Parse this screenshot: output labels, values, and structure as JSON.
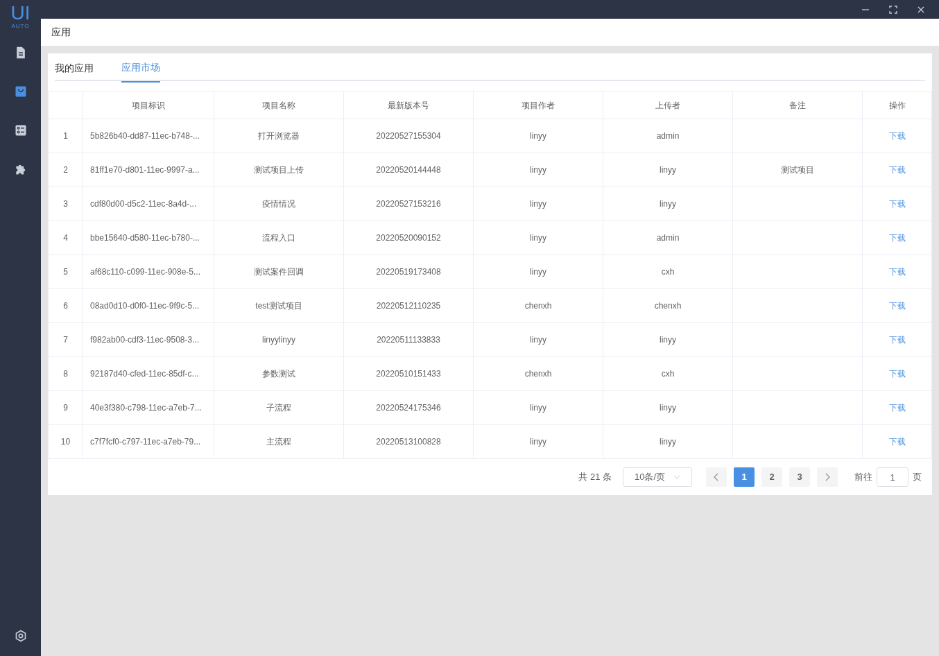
{
  "logo": {
    "title": "UI",
    "subtitle": "AUTO"
  },
  "sidebar": {
    "items": [
      {
        "kind": "document",
        "selected": false
      },
      {
        "kind": "bag",
        "selected": true
      },
      {
        "kind": "checklist",
        "selected": false
      },
      {
        "kind": "puzzle",
        "selected": false
      }
    ]
  },
  "header": {
    "title": "应用"
  },
  "tabs": [
    {
      "label": "我的应用",
      "selected": false
    },
    {
      "label": "应用市场",
      "selected": true
    }
  ],
  "table": {
    "columns": [
      "",
      "项目标识",
      "项目名称",
      "最新版本号",
      "项目作者",
      "上传者",
      "备注",
      "操作"
    ],
    "rows": [
      [
        "1",
        "5b826b40-dd87-11ec-b748-...",
        "打开浏览器",
        "20220527155304",
        "linyy",
        "admin",
        "",
        "下载"
      ],
      [
        "2",
        "81ff1e70-d801-11ec-9997-a...",
        "测试项目上传",
        "20220520144448",
        "linyy",
        "linyy",
        "测试项目",
        "下载"
      ],
      [
        "3",
        "cdf80d00-d5c2-11ec-8a4d-...",
        "疫情情况",
        "20220527153216",
        "linyy",
        "linyy",
        "",
        "下载"
      ],
      [
        "4",
        "bbe15640-d580-11ec-b780-...",
        "流程入口",
        "20220520090152",
        "linyy",
        "admin",
        "",
        "下载"
      ],
      [
        "5",
        "af68c110-c099-11ec-908e-5...",
        "测试案件回调",
        "20220519173408",
        "linyy",
        "cxh",
        "",
        "下载"
      ],
      [
        "6",
        "08ad0d10-d0f0-11ec-9f9c-5...",
        "test测试项目",
        "20220512110235",
        "chenxh",
        "chenxh",
        "",
        "下载"
      ],
      [
        "7",
        "f982ab00-cdf3-11ec-9508-3...",
        "linyylinyy",
        "20220511133833",
        "linyy",
        "linyy",
        "",
        "下载"
      ],
      [
        "8",
        "92187d40-cfed-11ec-85df-c...",
        "参数测试",
        "20220510151433",
        "chenxh",
        "cxh",
        "",
        "下载"
      ],
      [
        "9",
        "40e3f380-c798-11ec-a7eb-7...",
        "子流程",
        "20220524175346",
        "linyy",
        "linyy",
        "",
        "下载"
      ],
      [
        "10",
        "c7f7fcf0-c797-11ec-a7eb-79...",
        "主流程",
        "20220513100828",
        "linyy",
        "linyy",
        "",
        "下载"
      ]
    ]
  },
  "pagination": {
    "total": "共 21 条",
    "page_size": "10条/页",
    "pages": [
      {
        "label": "1",
        "selected": true
      },
      {
        "label": "2",
        "selected": false
      },
      {
        "label": "3",
        "selected": false
      }
    ],
    "goto_label": "前往",
    "goto_value": "1",
    "goto_suffix": "页"
  }
}
